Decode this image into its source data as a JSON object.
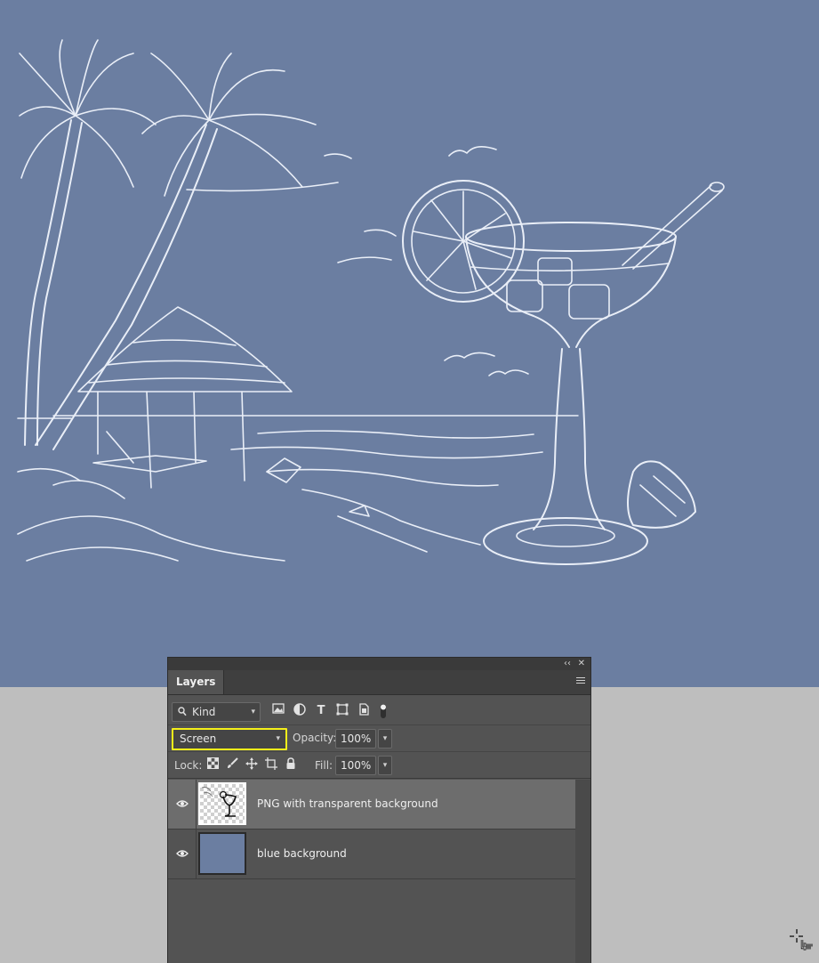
{
  "canvas": {
    "background_color": "#6b7ea1",
    "artwork": "beach-cocktail-sketch"
  },
  "layers_panel": {
    "tab_label": "Layers",
    "collapse_glyph": "‹‹",
    "close_glyph": "✕",
    "filter": {
      "kind_label": "Kind",
      "icons": [
        "image-filter-icon",
        "adjustment-filter-icon",
        "type-filter-icon",
        "shape-filter-icon",
        "smart-object-filter-icon",
        "filter-toggle-icon"
      ]
    },
    "blend_mode": "Screen",
    "opacity_label": "Opacity:",
    "opacity_value": "100%",
    "lock_label": "Lock:",
    "lock_icons": [
      "lock-transparent-pixels-icon",
      "lock-image-pixels-icon",
      "lock-position-icon",
      "lock-artboard-icon",
      "lock-all-icon"
    ],
    "fill_label": "Fill:",
    "fill_value": "100%",
    "layers": [
      {
        "name": "PNG with transparent background",
        "visible": true,
        "selected": true,
        "thumbnail": "transparent-cocktail-thumbnail"
      },
      {
        "name": "blue background",
        "visible": true,
        "selected": false,
        "thumbnail": "solid-blue-thumbnail"
      }
    ],
    "highlight_color": "#f5f01a"
  }
}
